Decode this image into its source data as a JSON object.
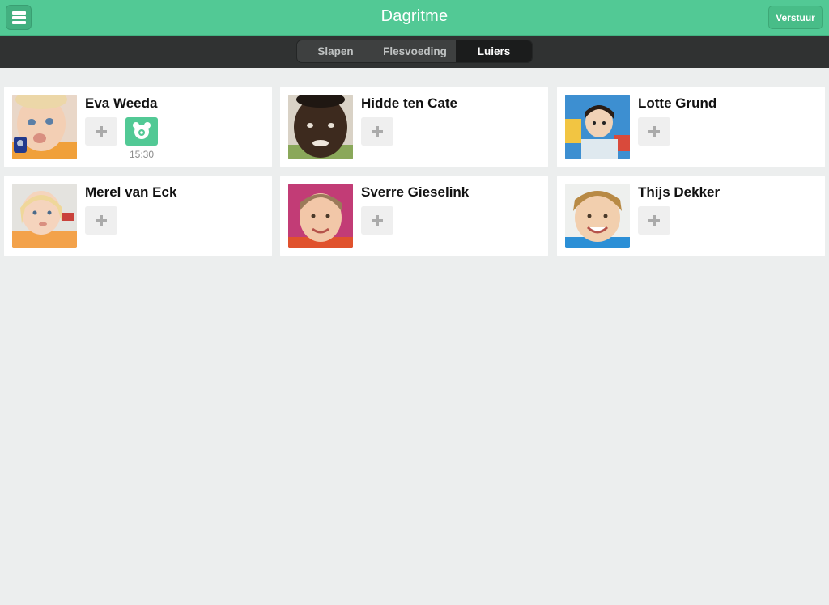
{
  "header": {
    "title": "Dagritme",
    "menu_icon": "hamburger-menu-icon",
    "send_label": "Verstuur"
  },
  "tabs": [
    {
      "label": "Slapen",
      "active": false
    },
    {
      "label": "Flesvoeding",
      "active": false
    },
    {
      "label": "Luiers",
      "active": true
    }
  ],
  "children": [
    {
      "name": "Eva Weeda",
      "entries": [
        {
          "icon": "diaper-icon",
          "time": "15:30"
        }
      ]
    },
    {
      "name": "Hidde ten Cate",
      "entries": []
    },
    {
      "name": "Lotte Grund",
      "entries": []
    },
    {
      "name": "Merel van Eck",
      "entries": []
    },
    {
      "name": "Sverre Gieselink",
      "entries": []
    },
    {
      "name": "Thijs Dekker",
      "entries": []
    }
  ],
  "colors": {
    "accent": "#52c995",
    "tabbar": "#303232",
    "background": "#eceeee"
  }
}
